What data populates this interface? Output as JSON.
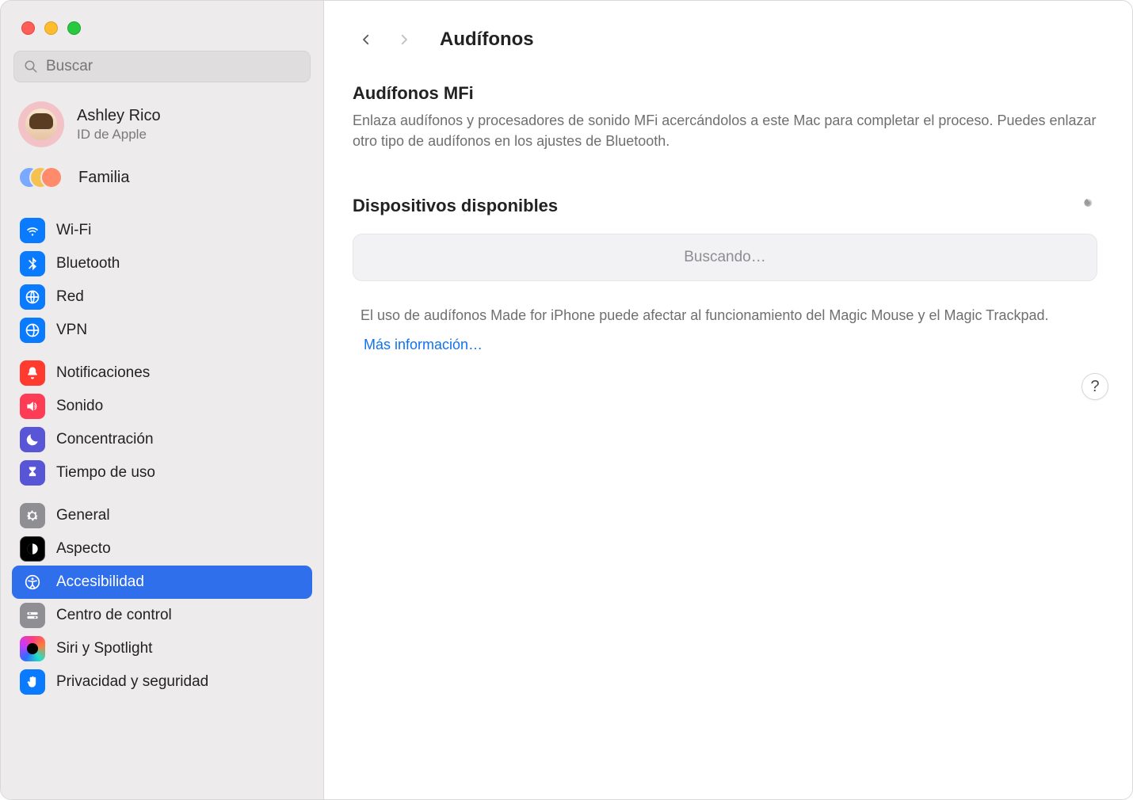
{
  "window": {
    "title": "Audífonos"
  },
  "search": {
    "placeholder": "Buscar"
  },
  "account": {
    "name": "Ashley Rico",
    "subtitle": "ID de Apple"
  },
  "family": {
    "label": "Familia"
  },
  "sidebar": {
    "groups": [
      [
        {
          "label": "Wi-Fi"
        },
        {
          "label": "Bluetooth"
        },
        {
          "label": "Red"
        },
        {
          "label": "VPN"
        }
      ],
      [
        {
          "label": "Notificaciones"
        },
        {
          "label": "Sonido"
        },
        {
          "label": "Concentración"
        },
        {
          "label": "Tiempo de uso"
        }
      ],
      [
        {
          "label": "General"
        },
        {
          "label": "Aspecto"
        },
        {
          "label": "Accesibilidad"
        },
        {
          "label": "Centro de control"
        },
        {
          "label": "Siri y Spotlight"
        },
        {
          "label": "Privacidad y seguridad"
        }
      ]
    ]
  },
  "main": {
    "mfi_title": "Audífonos MFi",
    "mfi_desc": "Enlaza audífonos y procesadores de sonido MFi acercándolos a este Mac para completar el proceso. Puedes enlazar otro tipo de audífonos en los ajustes de Bluetooth.",
    "available_title": "Dispositivos disponibles",
    "searching": "Buscando…",
    "note": "El uso de audífonos Made for iPhone puede afectar al funcionamiento del Magic Mouse y el Magic Trackpad.",
    "more": "Más información…",
    "help": "?"
  }
}
